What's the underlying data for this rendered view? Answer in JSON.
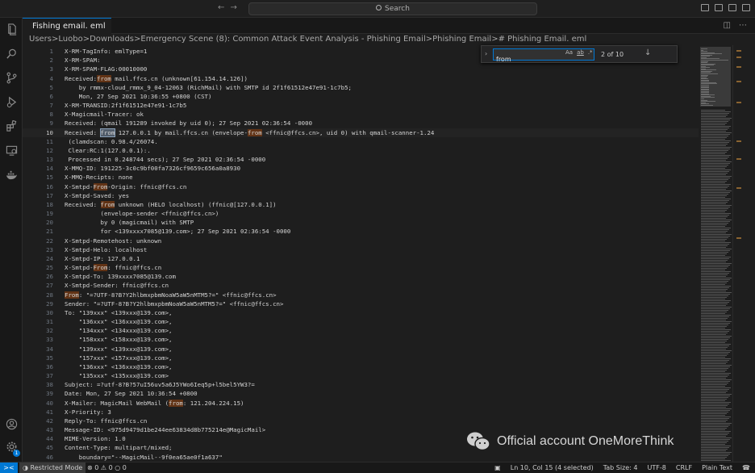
{
  "titlebar": {
    "search_label": "Search"
  },
  "tab": {
    "label": "Fishing email. eml"
  },
  "breadcrumb": "Users>Luobo>Downloads>Emergency Scene (8): Common Attack Event Analysis - Phishing Email>Phishing Email>#  Phishing Email. eml",
  "find": {
    "query": "from",
    "match_case": "Aa",
    "whole_word": "ab",
    "regex": ".*",
    "count": "2 of 10"
  },
  "editor": {
    "current_line": 10,
    "lines": [
      {
        "n": "1",
        "segs": [
          {
            "t": "X-RM-TagInfo: emlType=1"
          }
        ]
      },
      {
        "n": "2",
        "segs": [
          {
            "t": "X-RM-SPAM:"
          }
        ]
      },
      {
        "n": "3",
        "segs": [
          {
            "t": "X-RM-SPAM-FLAG:00010000"
          }
        ]
      },
      {
        "n": "4",
        "segs": [
          {
            "t": "Received:"
          },
          {
            "t": "from",
            "hl": 1
          },
          {
            "t": " mail.ffcs.cn (unknown[61.154.14.126])"
          }
        ]
      },
      {
        "n": "5",
        "segs": [
          {
            "t": "    by rmmx-cloud_rmmx_9_04-12063 (RichMail) with SMTP id 2f1f61512e47e91-1c7b5;"
          }
        ]
      },
      {
        "n": "6",
        "segs": [
          {
            "t": "    Mon, 27 Sep 2021 10:36:55 +0800 (CST)"
          }
        ]
      },
      {
        "n": "7",
        "segs": [
          {
            "t": "X-RM-TRANSID:2f1f61512e47e91-1c7b5"
          }
        ]
      },
      {
        "n": "8",
        "segs": [
          {
            "t": "X-Magicmail-Tracer: ok"
          }
        ]
      },
      {
        "n": "9",
        "segs": [
          {
            "t": "Received: (qmail 191289 invoked by uid 0); 27 Sep 2021 02:36:54 -0000"
          }
        ]
      },
      {
        "n": "10",
        "segs": [
          {
            "t": "Received: "
          },
          {
            "t": "from",
            "hl": 2
          },
          {
            "t": " 127.0.0.1 by mail.ffcs.cn (envelope-"
          },
          {
            "t": "from",
            "hl": 1
          },
          {
            "t": " <ffnic@ffcs.cn>, uid 0) with qmail-scanner-1.24"
          }
        ]
      },
      {
        "n": "11",
        "segs": [
          {
            "t": " (clamdscan: 0.98.4/26074."
          }
        ]
      },
      {
        "n": "12",
        "segs": [
          {
            "t": " Clear:RC:1(127.0.0.1):."
          }
        ]
      },
      {
        "n": "13",
        "segs": [
          {
            "t": " Processed in 0.248744 secs); 27 Sep 2021 02:36:54 -0000"
          }
        ]
      },
      {
        "n": "14",
        "segs": [
          {
            "t": "X-MMQ-ID: 191225-3c0c9bf00fa7326cf9659c656a0a8930"
          }
        ]
      },
      {
        "n": "15",
        "segs": [
          {
            "t": "X-MMQ-Recipts: none"
          }
        ]
      },
      {
        "n": "16",
        "segs": [
          {
            "t": "X-Smtpd-"
          },
          {
            "t": "From",
            "hl": 1
          },
          {
            "t": "-Origin: ffnic@ffcs.cn"
          }
        ]
      },
      {
        "n": "17",
        "segs": [
          {
            "t": "X-Smtpd-Saved: yes"
          }
        ]
      },
      {
        "n": "18",
        "segs": [
          {
            "t": "Received: "
          },
          {
            "t": "from",
            "hl": 1
          },
          {
            "t": " unknown (HELO localhost) (ffnic@[127.0.0.1])"
          }
        ]
      },
      {
        "n": "19",
        "segs": [
          {
            "t": "          (envelope-sender <ffnic@ffcs.cn>)"
          }
        ]
      },
      {
        "n": "20",
        "segs": [
          {
            "t": "          by 0 (magicmail) with SMTP"
          }
        ]
      },
      {
        "n": "21",
        "segs": [
          {
            "t": "          for <139xxxx7085@139.com>; 27 Sep 2021 02:36:54 -0000"
          }
        ]
      },
      {
        "n": "22",
        "segs": [
          {
            "t": "X-Smtpd-Remotehost: unknown"
          }
        ]
      },
      {
        "n": "23",
        "segs": [
          {
            "t": "X-Smtpd-Helo: localhost"
          }
        ]
      },
      {
        "n": "24",
        "segs": [
          {
            "t": "X-Smtpd-IP: 127.0.0.1"
          }
        ]
      },
      {
        "n": "25",
        "segs": [
          {
            "t": "X-Smtpd-"
          },
          {
            "t": "From",
            "hl": 1
          },
          {
            "t": ": ffnic@ffcs.cn"
          }
        ]
      },
      {
        "n": "26",
        "segs": [
          {
            "t": "X-Smtpd-To: 139xxxx7085@139.com"
          }
        ]
      },
      {
        "n": "27",
        "segs": [
          {
            "t": "X-Smtpd-Sender: ffnic@ffcs.cn"
          }
        ]
      },
      {
        "n": "28",
        "segs": [
          {
            "t": "From",
            "hl": 1
          },
          {
            "t": ": \"=?UTF-8?B?Y2hlbmxpbmNoaW5aW5nMTM5?=\" <ffnic@ffcs.cn>"
          }
        ]
      },
      {
        "n": "29",
        "segs": [
          {
            "t": "Sender: \"=?UTF-8?B?Y2hlbmxpbmNoaW5aW5nMTM5?=\" <ffnic@ffcs.cn>"
          }
        ]
      },
      {
        "n": "30",
        "segs": [
          {
            "t": "To: \"139xxx\" <139xxx@139.com>,"
          }
        ]
      },
      {
        "n": "31",
        "segs": [
          {
            "t": "    \"136xxx\" <136xxx@139.com>,"
          }
        ]
      },
      {
        "n": "32",
        "segs": [
          {
            "t": "    \"134xxx\" <134xxx@139.com>,"
          }
        ]
      },
      {
        "n": "33",
        "segs": [
          {
            "t": "    \"158xxx\" <158xxx@139.com>,"
          }
        ]
      },
      {
        "n": "34",
        "segs": [
          {
            "t": "    \"139xxx\" <139xxx@139.com>,"
          }
        ]
      },
      {
        "n": "35",
        "segs": [
          {
            "t": "    \"157xxx\" <157xxx@139.com>,"
          }
        ]
      },
      {
        "n": "36",
        "segs": [
          {
            "t": "    \"136xxx\" <136xxx@139.com>,"
          }
        ]
      },
      {
        "n": "37",
        "segs": [
          {
            "t": "    \"135xxx\" <135xxx@139.com>"
          }
        ]
      },
      {
        "n": "38",
        "segs": [
          {
            "t": "Subject: =?utf-8?B?57uI56uv5a6J5YWo6Ieq5p+l5bel5YW3?="
          }
        ]
      },
      {
        "n": "39",
        "segs": [
          {
            "t": "Date: Mon, 27 Sep 2021 10:36:54 +0800"
          }
        ]
      },
      {
        "n": "40",
        "segs": [
          {
            "t": "X-Mailer: MagicMail WebMail ("
          },
          {
            "t": "from",
            "hl": 1
          },
          {
            "t": ": 121.204.224.15)"
          }
        ]
      },
      {
        "n": "41",
        "segs": [
          {
            "t": "X-Priority: 3"
          }
        ]
      },
      {
        "n": "42",
        "segs": [
          {
            "t": "Reply-To: ffnic@ffcs.cn"
          }
        ]
      },
      {
        "n": "43",
        "segs": [
          {
            "t": "Message-ID: <975d9479d1be244ee63834d8b775214e@MagicMail>"
          }
        ]
      },
      {
        "n": "44",
        "segs": [
          {
            "t": "MIME-Version: 1.0"
          }
        ]
      },
      {
        "n": "45",
        "segs": [
          {
            "t": "Content-Type: multipart/mixed;"
          }
        ]
      },
      {
        "n": "46",
        "segs": [
          {
            "t": "    boundary=\"--MagicMail--9f0ea65ae0f1a637\""
          }
        ]
      }
    ]
  },
  "watermark": "Official account OneMoreThink",
  "statusbar": {
    "remote": "><",
    "restricted": "Restricted Mode",
    "problems": "⊗ 0 ⚠ 0",
    "ports": "○ 0",
    "position": "Ln 10, Col 15 (4 selected)",
    "tab_size": "Tab Size: 4",
    "encoding": "UTF-8",
    "eol": "CRLF",
    "language": "Plain Text",
    "badge": "1"
  },
  "colors": {
    "accent": "#0078d4",
    "match_highlight": "#623315",
    "current_match": "#515c6a"
  }
}
